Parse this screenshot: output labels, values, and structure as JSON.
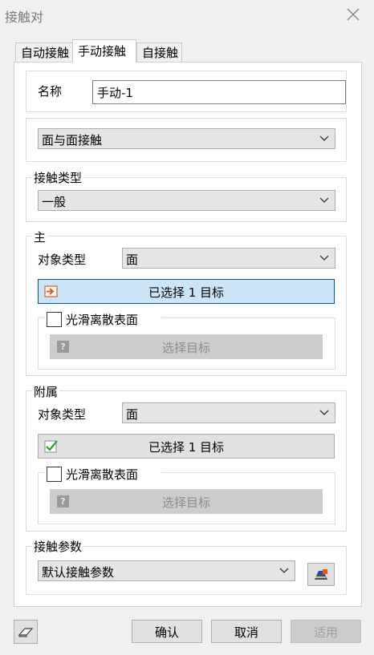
{
  "window": {
    "title": "接触对"
  },
  "tabs": [
    {
      "label": "自动接触"
    },
    {
      "label": "手动接触"
    },
    {
      "label": "自接触"
    }
  ],
  "name": {
    "label": "名称",
    "value": "手动-1"
  },
  "contact_mode": {
    "selected": "面与面接触"
  },
  "contact_type": {
    "legend": "接触类型",
    "selected": "一般"
  },
  "master": {
    "legend": "主",
    "object_type_label": "对象类型",
    "object_type_value": "面",
    "selection_button": "已选择 1 目标",
    "smooth_label": "光滑离散表面",
    "select_target_button": "选择目标"
  },
  "slave": {
    "legend": "附属",
    "object_type_label": "对象类型",
    "object_type_value": "面",
    "selection_button": "已选择 1 目标",
    "smooth_label": "光滑离散表面",
    "select_target_button": "选择目标"
  },
  "contact_params": {
    "legend": "接触参数",
    "selected": "默认接触参数"
  },
  "footer": {
    "ok": "确认",
    "cancel": "取消",
    "apply": "适用"
  },
  "colors": {
    "selection_active": "#cce4f7",
    "selection_border": "#005499",
    "check_green": "#2e9e2e",
    "arrow_orange": "#e8581a"
  }
}
